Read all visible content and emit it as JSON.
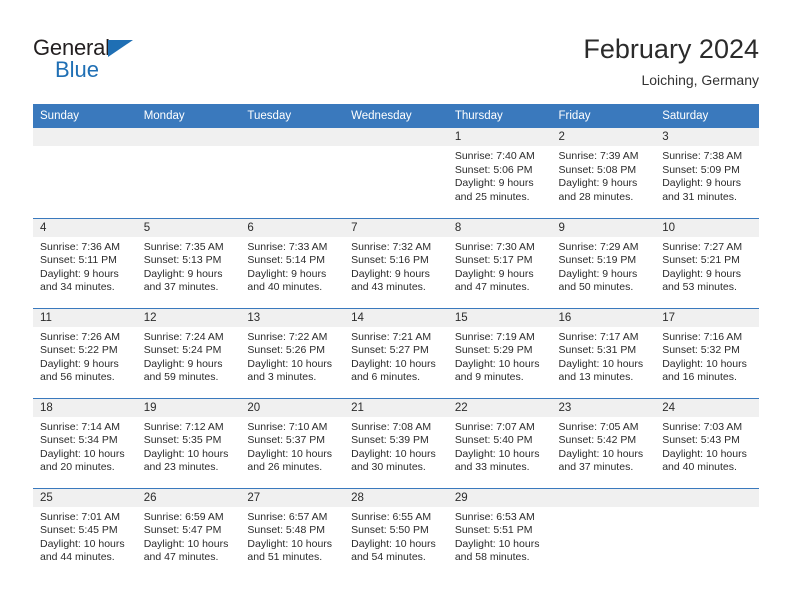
{
  "brand": {
    "name_part1": "General",
    "name_part2": "Blue",
    "triangle_color": "#1f6fb4"
  },
  "header": {
    "month_title": "February 2024",
    "location": "Loiching, Germany",
    "header_bg": "#3a79bd",
    "band_bg": "#f0f0f0"
  },
  "weekday_headers": [
    "Sunday",
    "Monday",
    "Tuesday",
    "Wednesday",
    "Thursday",
    "Friday",
    "Saturday"
  ],
  "weeks": [
    [
      {
        "day": "",
        "sunrise": "",
        "sunset": "",
        "daylight1": "",
        "daylight2": ""
      },
      {
        "day": "",
        "sunrise": "",
        "sunset": "",
        "daylight1": "",
        "daylight2": ""
      },
      {
        "day": "",
        "sunrise": "",
        "sunset": "",
        "daylight1": "",
        "daylight2": ""
      },
      {
        "day": "",
        "sunrise": "",
        "sunset": "",
        "daylight1": "",
        "daylight2": ""
      },
      {
        "day": "1",
        "sunrise": "Sunrise: 7:40 AM",
        "sunset": "Sunset: 5:06 PM",
        "daylight1": "Daylight: 9 hours",
        "daylight2": "and 25 minutes."
      },
      {
        "day": "2",
        "sunrise": "Sunrise: 7:39 AM",
        "sunset": "Sunset: 5:08 PM",
        "daylight1": "Daylight: 9 hours",
        "daylight2": "and 28 minutes."
      },
      {
        "day": "3",
        "sunrise": "Sunrise: 7:38 AM",
        "sunset": "Sunset: 5:09 PM",
        "daylight1": "Daylight: 9 hours",
        "daylight2": "and 31 minutes."
      }
    ],
    [
      {
        "day": "4",
        "sunrise": "Sunrise: 7:36 AM",
        "sunset": "Sunset: 5:11 PM",
        "daylight1": "Daylight: 9 hours",
        "daylight2": "and 34 minutes."
      },
      {
        "day": "5",
        "sunrise": "Sunrise: 7:35 AM",
        "sunset": "Sunset: 5:13 PM",
        "daylight1": "Daylight: 9 hours",
        "daylight2": "and 37 minutes."
      },
      {
        "day": "6",
        "sunrise": "Sunrise: 7:33 AM",
        "sunset": "Sunset: 5:14 PM",
        "daylight1": "Daylight: 9 hours",
        "daylight2": "and 40 minutes."
      },
      {
        "day": "7",
        "sunrise": "Sunrise: 7:32 AM",
        "sunset": "Sunset: 5:16 PM",
        "daylight1": "Daylight: 9 hours",
        "daylight2": "and 43 minutes."
      },
      {
        "day": "8",
        "sunrise": "Sunrise: 7:30 AM",
        "sunset": "Sunset: 5:17 PM",
        "daylight1": "Daylight: 9 hours",
        "daylight2": "and 47 minutes."
      },
      {
        "day": "9",
        "sunrise": "Sunrise: 7:29 AM",
        "sunset": "Sunset: 5:19 PM",
        "daylight1": "Daylight: 9 hours",
        "daylight2": "and 50 minutes."
      },
      {
        "day": "10",
        "sunrise": "Sunrise: 7:27 AM",
        "sunset": "Sunset: 5:21 PM",
        "daylight1": "Daylight: 9 hours",
        "daylight2": "and 53 minutes."
      }
    ],
    [
      {
        "day": "11",
        "sunrise": "Sunrise: 7:26 AM",
        "sunset": "Sunset: 5:22 PM",
        "daylight1": "Daylight: 9 hours",
        "daylight2": "and 56 minutes."
      },
      {
        "day": "12",
        "sunrise": "Sunrise: 7:24 AM",
        "sunset": "Sunset: 5:24 PM",
        "daylight1": "Daylight: 9 hours",
        "daylight2": "and 59 minutes."
      },
      {
        "day": "13",
        "sunrise": "Sunrise: 7:22 AM",
        "sunset": "Sunset: 5:26 PM",
        "daylight1": "Daylight: 10 hours",
        "daylight2": "and 3 minutes."
      },
      {
        "day": "14",
        "sunrise": "Sunrise: 7:21 AM",
        "sunset": "Sunset: 5:27 PM",
        "daylight1": "Daylight: 10 hours",
        "daylight2": "and 6 minutes."
      },
      {
        "day": "15",
        "sunrise": "Sunrise: 7:19 AM",
        "sunset": "Sunset: 5:29 PM",
        "daylight1": "Daylight: 10 hours",
        "daylight2": "and 9 minutes."
      },
      {
        "day": "16",
        "sunrise": "Sunrise: 7:17 AM",
        "sunset": "Sunset: 5:31 PM",
        "daylight1": "Daylight: 10 hours",
        "daylight2": "and 13 minutes."
      },
      {
        "day": "17",
        "sunrise": "Sunrise: 7:16 AM",
        "sunset": "Sunset: 5:32 PM",
        "daylight1": "Daylight: 10 hours",
        "daylight2": "and 16 minutes."
      }
    ],
    [
      {
        "day": "18",
        "sunrise": "Sunrise: 7:14 AM",
        "sunset": "Sunset: 5:34 PM",
        "daylight1": "Daylight: 10 hours",
        "daylight2": "and 20 minutes."
      },
      {
        "day": "19",
        "sunrise": "Sunrise: 7:12 AM",
        "sunset": "Sunset: 5:35 PM",
        "daylight1": "Daylight: 10 hours",
        "daylight2": "and 23 minutes."
      },
      {
        "day": "20",
        "sunrise": "Sunrise: 7:10 AM",
        "sunset": "Sunset: 5:37 PM",
        "daylight1": "Daylight: 10 hours",
        "daylight2": "and 26 minutes."
      },
      {
        "day": "21",
        "sunrise": "Sunrise: 7:08 AM",
        "sunset": "Sunset: 5:39 PM",
        "daylight1": "Daylight: 10 hours",
        "daylight2": "and 30 minutes."
      },
      {
        "day": "22",
        "sunrise": "Sunrise: 7:07 AM",
        "sunset": "Sunset: 5:40 PM",
        "daylight1": "Daylight: 10 hours",
        "daylight2": "and 33 minutes."
      },
      {
        "day": "23",
        "sunrise": "Sunrise: 7:05 AM",
        "sunset": "Sunset: 5:42 PM",
        "daylight1": "Daylight: 10 hours",
        "daylight2": "and 37 minutes."
      },
      {
        "day": "24",
        "sunrise": "Sunrise: 7:03 AM",
        "sunset": "Sunset: 5:43 PM",
        "daylight1": "Daylight: 10 hours",
        "daylight2": "and 40 minutes."
      }
    ],
    [
      {
        "day": "25",
        "sunrise": "Sunrise: 7:01 AM",
        "sunset": "Sunset: 5:45 PM",
        "daylight1": "Daylight: 10 hours",
        "daylight2": "and 44 minutes."
      },
      {
        "day": "26",
        "sunrise": "Sunrise: 6:59 AM",
        "sunset": "Sunset: 5:47 PM",
        "daylight1": "Daylight: 10 hours",
        "daylight2": "and 47 minutes."
      },
      {
        "day": "27",
        "sunrise": "Sunrise: 6:57 AM",
        "sunset": "Sunset: 5:48 PM",
        "daylight1": "Daylight: 10 hours",
        "daylight2": "and 51 minutes."
      },
      {
        "day": "28",
        "sunrise": "Sunrise: 6:55 AM",
        "sunset": "Sunset: 5:50 PM",
        "daylight1": "Daylight: 10 hours",
        "daylight2": "and 54 minutes."
      },
      {
        "day": "29",
        "sunrise": "Sunrise: 6:53 AM",
        "sunset": "Sunset: 5:51 PM",
        "daylight1": "Daylight: 10 hours",
        "daylight2": "and 58 minutes."
      },
      {
        "day": "",
        "sunrise": "",
        "sunset": "",
        "daylight1": "",
        "daylight2": ""
      },
      {
        "day": "",
        "sunrise": "",
        "sunset": "",
        "daylight1": "",
        "daylight2": ""
      }
    ]
  ]
}
